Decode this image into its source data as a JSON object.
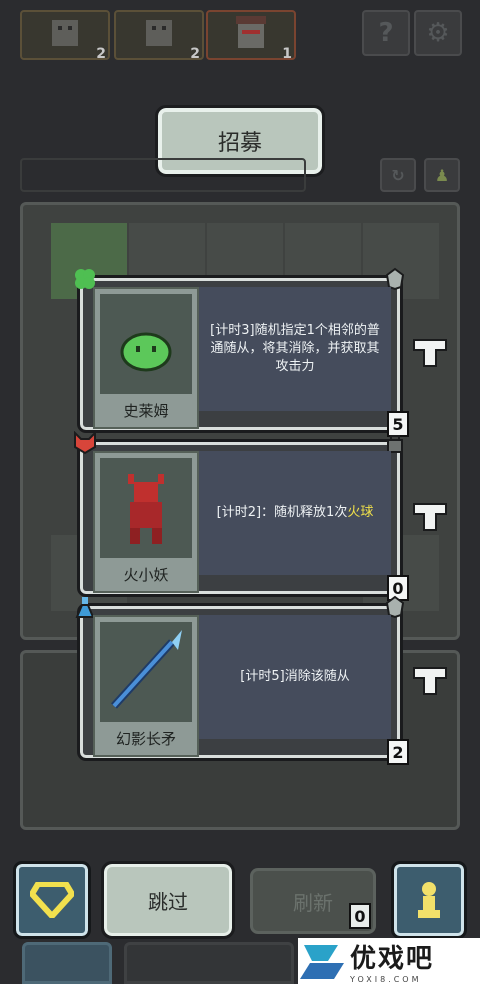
{
  "top_slots": [
    {
      "count": "2"
    },
    {
      "count": "2"
    },
    {
      "count": "1"
    }
  ],
  "top_buttons": {
    "help_symbol": "?",
    "settings_symbol": "⚙"
  },
  "recruit": {
    "label": "招募"
  },
  "cards": [
    {
      "name": "史莱姆",
      "desc": "[计时3]随机指定1个相邻的普通随从，将其消除，并获取其攻击力",
      "level": "5"
    },
    {
      "name": "火小妖",
      "desc_prefix": "[计时2]：随机释放1次",
      "desc_highlight": "火球",
      "level": "0"
    },
    {
      "name": "幻影长矛",
      "desc": "[计时5]消除该随从",
      "level": "2"
    }
  ],
  "bottom": {
    "skip_label": "跳过",
    "refresh_label": "刷新",
    "refresh_count": "0"
  },
  "colors": {
    "highlight": "#f0e04a",
    "accent": "#3d5d6e"
  },
  "watermark": {
    "text": "优戏吧",
    "sub": "YOXI8.COM"
  }
}
